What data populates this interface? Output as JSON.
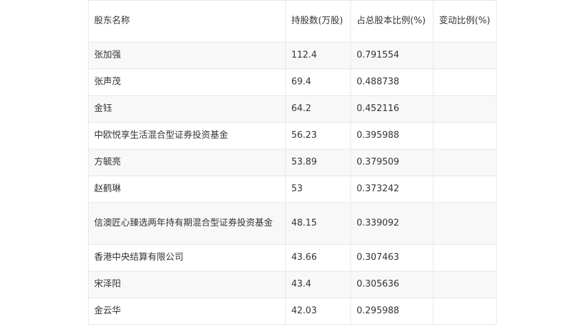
{
  "table": {
    "headers": [
      "股东名称",
      "持股数(万股)",
      "占总股本比例(%)",
      "变动比例(%)"
    ],
    "rows": [
      {
        "name": "张加强",
        "shares": "112.4",
        "ratio": "0.791554",
        "change": ""
      },
      {
        "name": "张声茂",
        "shares": "69.4",
        "ratio": "0.488738",
        "change": ""
      },
      {
        "name": "金钰",
        "shares": "64.2",
        "ratio": "0.452116",
        "change": ""
      },
      {
        "name": "中欧悦享生活混合型证券投资基金",
        "shares": "56.23",
        "ratio": "0.395988",
        "change": ""
      },
      {
        "name": "方毓亮",
        "shares": "53.89",
        "ratio": "0.379509",
        "change": ""
      },
      {
        "name": "赵鹤琳",
        "shares": "53",
        "ratio": "0.373242",
        "change": ""
      },
      {
        "name": "信澳匠心臻选两年持有期混合型证券投资基金",
        "shares": "48.15",
        "ratio": "0.339092",
        "change": ""
      },
      {
        "name": "香港中央结算有限公司",
        "shares": "43.66",
        "ratio": "0.307463",
        "change": ""
      },
      {
        "name": "宋泽阳",
        "shares": "43.4",
        "ratio": "0.305636",
        "change": ""
      },
      {
        "name": "金云华",
        "shares": "42.03",
        "ratio": "0.295988",
        "change": ""
      }
    ]
  }
}
